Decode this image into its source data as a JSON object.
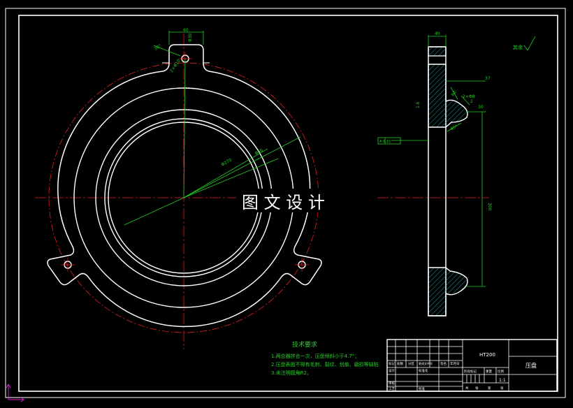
{
  "watermark": "图 文 设 计",
  "surface_finish_note": "其余",
  "technical_requirements": {
    "title": "技术要求",
    "items": [
      "1.两合器拼合一次，压盘倾斜小于4.7°；",
      "2.压盘表面不得有毛刺、裂纹、划痕、磨损等缺陷",
      "3.未注明圆角R2。"
    ]
  },
  "dimensions": {
    "top_width": "60",
    "tab_width": "Φ30",
    "hole_angle": "30°",
    "hole_dia": "2×Φ10",
    "inner_dia": "Φ270",
    "outer_dia": "Φ56",
    "side_thickness": "40",
    "side_height": "300",
    "side_right": "37",
    "datum": "A 0.15",
    "side_r1": "R2",
    "side_r2": "2×Φ8",
    "side_r3": "30",
    "side_r4": "1.6",
    "side_r5": "45°"
  },
  "title_block": {
    "material": "HT200",
    "part_name": "压盘",
    "scale": "1:1",
    "row_labels": [
      "标记",
      "设计",
      "审核",
      "工艺"
    ],
    "col_labels": [
      "处数",
      "分区",
      "更改文件号",
      "签名",
      "年月日"
    ],
    "mid_labels": [
      "阶段标记",
      "重量",
      "比例"
    ],
    "bottom_labels": [
      "共",
      "张",
      "第",
      "张"
    ],
    "std_label": "标准化",
    "approve_label": "批准"
  }
}
